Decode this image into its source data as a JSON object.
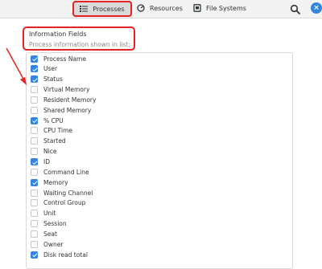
{
  "header": {
    "tabs": [
      {
        "label": "Processes",
        "icon": "list-icon",
        "active": true
      },
      {
        "label": "Resources",
        "icon": "gauge-icon",
        "active": false
      },
      {
        "label": "File Systems",
        "icon": "disk-icon",
        "active": false
      }
    ],
    "search_icon": "search-icon",
    "close_icon": "close-icon",
    "accent": "#3584e4",
    "highlight": "#e8231f"
  },
  "info": {
    "title": "Information Fields",
    "subtitle": "Process information shown in list:"
  },
  "fields": [
    {
      "label": "Process Name",
      "checked": true
    },
    {
      "label": "User",
      "checked": true
    },
    {
      "label": "Status",
      "checked": true
    },
    {
      "label": "Virtual Memory",
      "checked": false
    },
    {
      "label": "Resident Memory",
      "checked": false
    },
    {
      "label": "Shared Memory",
      "checked": false
    },
    {
      "label": "% CPU",
      "checked": true
    },
    {
      "label": "CPU Time",
      "checked": false
    },
    {
      "label": "Started",
      "checked": false
    },
    {
      "label": "Nice",
      "checked": false
    },
    {
      "label": "ID",
      "checked": true
    },
    {
      "label": "Command Line",
      "checked": false
    },
    {
      "label": "Memory",
      "checked": true
    },
    {
      "label": "Waiting Channel",
      "checked": false
    },
    {
      "label": "Control Group",
      "checked": false
    },
    {
      "label": "Unit",
      "checked": false
    },
    {
      "label": "Session",
      "checked": false
    },
    {
      "label": "Seat",
      "checked": false
    },
    {
      "label": "Owner",
      "checked": false
    },
    {
      "label": "Disk read total",
      "checked": true
    }
  ]
}
